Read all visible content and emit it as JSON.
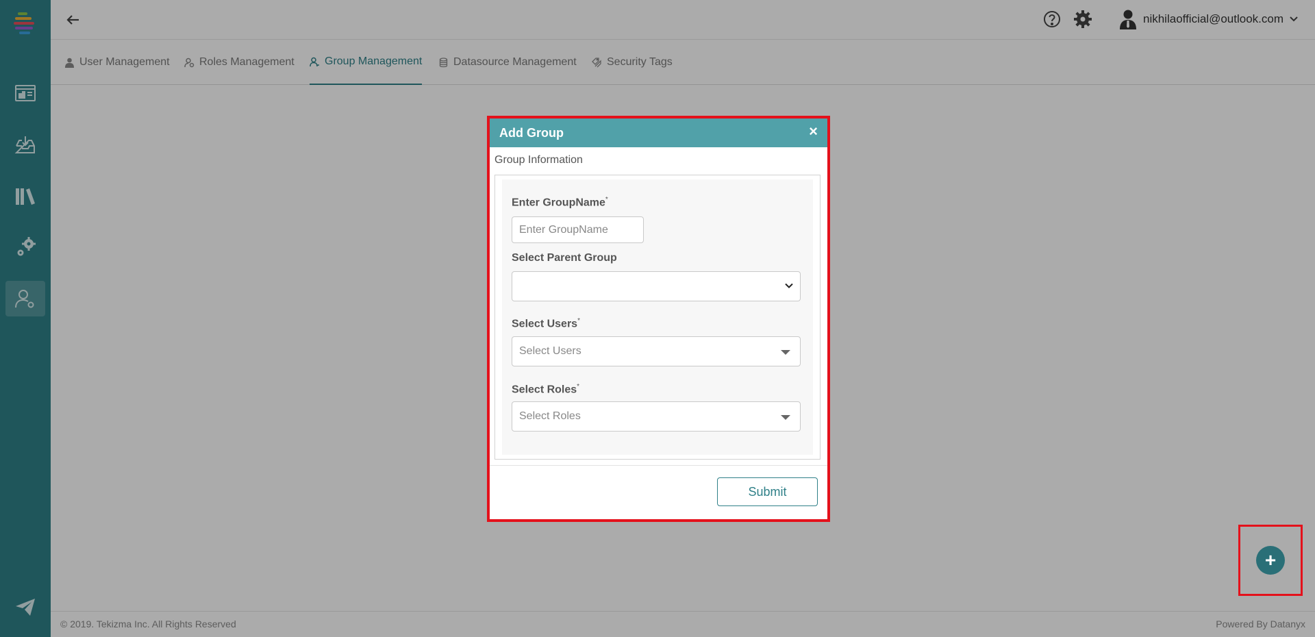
{
  "header": {
    "user_email": "nikhilaofficial@outlook.com"
  },
  "tabs": [
    {
      "label": "User Management",
      "icon": "user-icon"
    },
    {
      "label": "Roles Management",
      "icon": "user-role-icon"
    },
    {
      "label": "Group Management",
      "icon": "group-icon",
      "active": true
    },
    {
      "label": "Datasource Management",
      "icon": "database-icon"
    },
    {
      "label": "Security Tags",
      "icon": "tags-icon"
    }
  ],
  "sidebar": {
    "items": [
      {
        "icon": "dashboard-icon"
      },
      {
        "icon": "inbox-download-icon"
      },
      {
        "icon": "library-icon"
      },
      {
        "icon": "settings-gears-icon"
      },
      {
        "icon": "user-settings-icon",
        "active": true
      },
      {
        "icon": "send-icon"
      }
    ]
  },
  "modal": {
    "title": "Add Group",
    "close_symbol": "×",
    "section_title": "Group Information",
    "group_name": {
      "label": "Enter GroupName",
      "required_mark": "*",
      "placeholder": "Enter GroupName",
      "value": ""
    },
    "parent_group": {
      "label": "Select Parent Group",
      "value": ""
    },
    "users": {
      "label": "Select Users",
      "required_mark": "*",
      "placeholder": "Select Users"
    },
    "roles": {
      "label": "Select Roles",
      "required_mark": "*",
      "placeholder": "Select Roles"
    },
    "submit_label": "Submit"
  },
  "fab": {
    "symbol": "+"
  },
  "footer": {
    "copyright": "© 2019. Tekizma Inc. All Rights Reserved",
    "powered_by": "Powered By Datanyx"
  },
  "colors": {
    "primary": "#2f8088",
    "modal_header": "#51a1a9",
    "highlight": "#e4111b"
  }
}
